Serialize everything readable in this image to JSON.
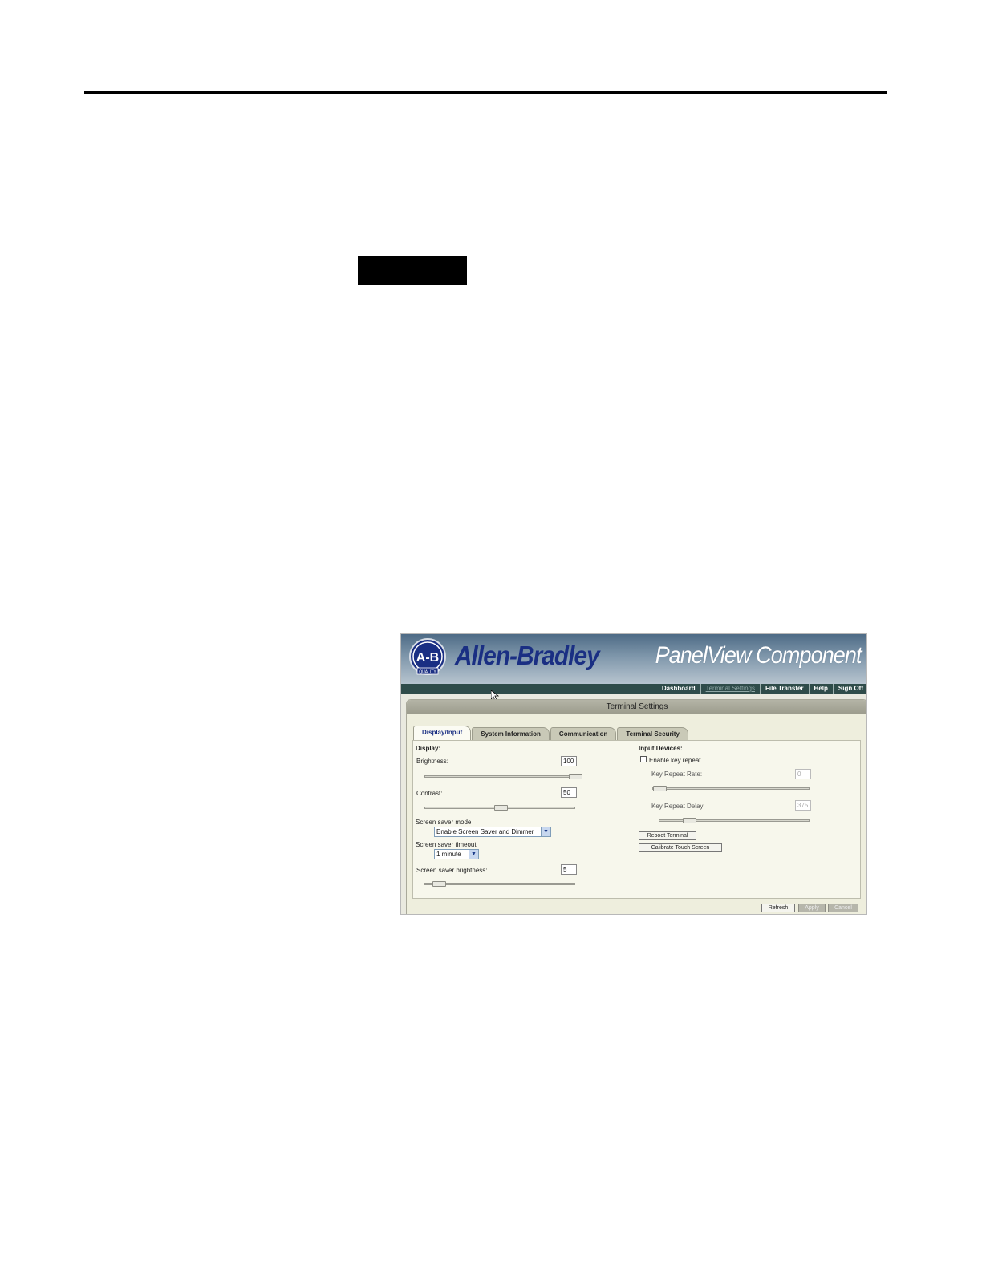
{
  "app": {
    "brand": "Allen-Bradley",
    "logo_text": "A-B",
    "logo_sub": "QUALITY",
    "product": "PanelView Component"
  },
  "nav": {
    "items": [
      {
        "label": "Dashboard",
        "current": false
      },
      {
        "label": "Terminal Settings",
        "current": true
      },
      {
        "label": "File Transfer",
        "current": false
      },
      {
        "label": "Help",
        "current": false
      },
      {
        "label": "Sign Off",
        "current": false
      }
    ]
  },
  "panel": {
    "title": "Terminal Settings",
    "tabs": [
      {
        "label": "Display/Input",
        "active": true
      },
      {
        "label": "System Information",
        "active": false
      },
      {
        "label": "Communication",
        "active": false
      },
      {
        "label": "Terminal Security",
        "active": false
      }
    ]
  },
  "display": {
    "section": "Display:",
    "brightness": {
      "label": "Brightness:",
      "value": "100",
      "level": 1.0
    },
    "contrast": {
      "label": "Contrast:",
      "value": "50",
      "level": 0.5
    },
    "screen_saver_mode": {
      "label": "Screen saver mode",
      "selected": "Enable Screen Saver and Dimmer"
    },
    "screen_saver_timeout": {
      "label": "Screen saver timeout",
      "selected": "1 minute"
    },
    "screen_saver_brightness": {
      "label": "Screen saver brightness:",
      "value": "5",
      "level": 0.05
    }
  },
  "input": {
    "section": "Input Devices:",
    "enable_key_repeat": {
      "label": "Enable key repeat",
      "checked": false
    },
    "key_repeat_rate": {
      "label": "Key Repeat Rate:",
      "value": "0",
      "level": 0.0
    },
    "key_repeat_delay": {
      "label": "Key Repeat Delay:",
      "value": "375",
      "level": 0.17
    },
    "reboot_label": "Reboot Terminal",
    "calibrate_label": "Calibrate Touch Screen"
  },
  "footer": {
    "refresh_label": "Refresh",
    "apply_label": "Apply",
    "cancel_label": "Cancel"
  },
  "colors": {
    "brand_blue": "#1a2f83",
    "nav_bar": "#2f4c4a",
    "panel_bg": "#eeeedd"
  }
}
